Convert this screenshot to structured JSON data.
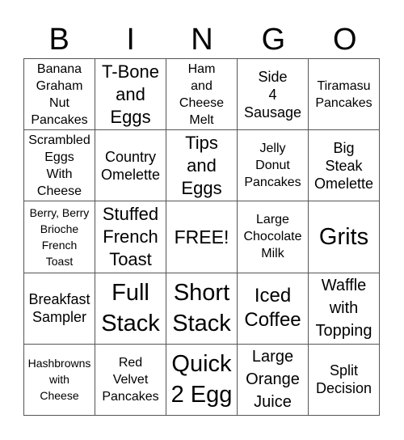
{
  "header": [
    "B",
    "I",
    "N",
    "G",
    "O"
  ],
  "cells": [
    "Banana\nGraham\nNut\nPancakes",
    "T-Bone\nand\nEggs",
    "Ham\nand\nCheese\nMelt",
    "Side\n4\nSausage",
    "Tiramasu\nPancakes",
    "Scrambled\nEggs\nWith\nCheese",
    "Country\nOmelette",
    "Tips\nand\nEggs",
    "Jelly\nDonut\nPancakes",
    "Big\nSteak\nOmelette",
    "Berry, Berry\nBrioche\nFrench\nToast",
    "Stuffed\nFrench\nToast",
    "FREE!",
    "Large\nChocolate\nMilk",
    "Grits",
    "Breakfast\nSampler",
    "Full\nStack",
    "Short\nStack",
    "Iced\nCoffee",
    "Waffle\nwith\nTopping",
    "Hashbrowns\nwith\nCheese",
    "Red\nVelvet\nPancakes",
    "Quick\n2 Egg",
    "Large\nOrange\nJuice",
    "Split\nDecision"
  ]
}
